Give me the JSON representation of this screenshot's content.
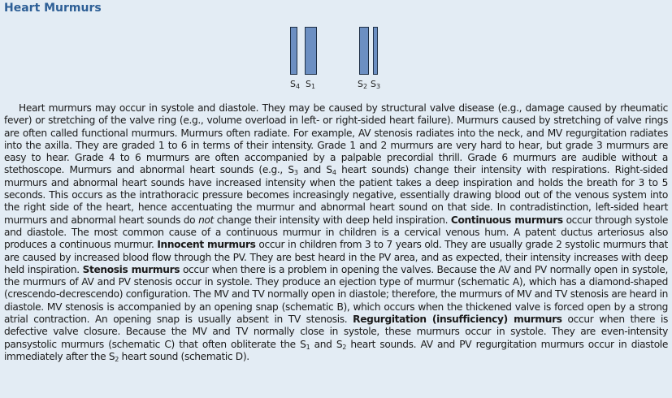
{
  "title": "Heart Murmurs",
  "diagram": {
    "labels": {
      "s4": "S",
      "s4_sub": "4",
      "s1": "S",
      "s1_sub": "1",
      "s2": "S",
      "s2_sub": "2",
      "s3": "S",
      "s3_sub": "3"
    },
    "bar_color": "#6c8fc2"
  },
  "text": {
    "p1": "Heart murmurs may occur in systole and diastole. They may be caused by structural valve disease (e.g., damage caused by rheumatic fever) or stretching of the valve ring (e.g., volume overload in left- or right-sided heart failure). Murmurs caused by stretching of valve rings are often called functional murmurs. Murmurs often radiate. For example, AV stenosis radiates into the neck, and MV regurgitation radiates into the axilla. They are graded 1 to 6 in terms of their intensity. Grade 1 and 2 murmurs are very hard to hear, but grade 3 murmurs are easy to hear. Grade 4 to 6 murmurs are often accompanied by a palpable precordial thrill. Grade 6 murmurs are audible without a stethoscope. Murmurs and abnormal heart sounds (e.g., S",
    "p1_sub1": "3",
    "p1b": " and S",
    "p1_sub2": "4",
    "p2": " heart sounds) change their intensity with respirations. Right-sided murmurs and abnormal heart sounds have increased intensity when the patient takes a deep inspiration and holds the breath for 3 to 5 seconds. This occurs as the intrathoracic pressure becomes increasingly negative, essentially drawing blood out of the venous system into the right side of the heart, hence accentuating the murmur and abnormal heart sound on that side. In contradistinction, left-sided heart murmurs and abnormal heart sounds do ",
    "not": "not",
    "p3": " change their intensity with deep held inspiration. ",
    "continuous": "Continuous murmurs",
    "p4": " occur through systole and diastole. The most common cause of a continuous murmur in children is a cervical venous hum. A patent ductus arteriosus also produces a continuous murmur. ",
    "innocent": "Innocent murmurs",
    "p5": " occur in children from 3 to 7 years old. They are usually grade 2 systolic murmurs that are caused by increased blood flow through the PV. They are best heard in the PV area, and as expected, their intensity increases with deep held inspiration. ",
    "stenosis": "Stenosis murmurs",
    "p6": " occur when there is a problem in opening the valves. Because the AV and PV normally open in systole, the murmurs of AV and PV stenosis occur in systole. They produce an ejection type of murmur (schematic A), which has a diamond-shaped (crescendo-decrescendo) configuration. The MV and TV normally open in diastole; therefore, the murmurs of MV and TV stenosis are heard in diastole. MV stenosis is accompanied by an opening snap (schematic B), which occurs when the thickened valve is forced open by a strong atrial contraction. An opening snap is usually absent in TV stenosis. ",
    "regurg": "Regurgitation (insufficiency) murmurs",
    "p7": " occur when there is defective valve closure. Because the MV and TV normally close in systole, these murmurs occur in systole. They are even-intensity pansystolic murmurs (schematic C) that often obliterate the S",
    "p7_sub1": "1",
    "p7b": " and S",
    "p7_sub2": "2",
    "p8": " heart sounds. AV and PV regurgitation murmurs occur in diastole immediately after the S",
    "p8_sub": "2",
    "p9": " heart sound (schematic D)."
  }
}
